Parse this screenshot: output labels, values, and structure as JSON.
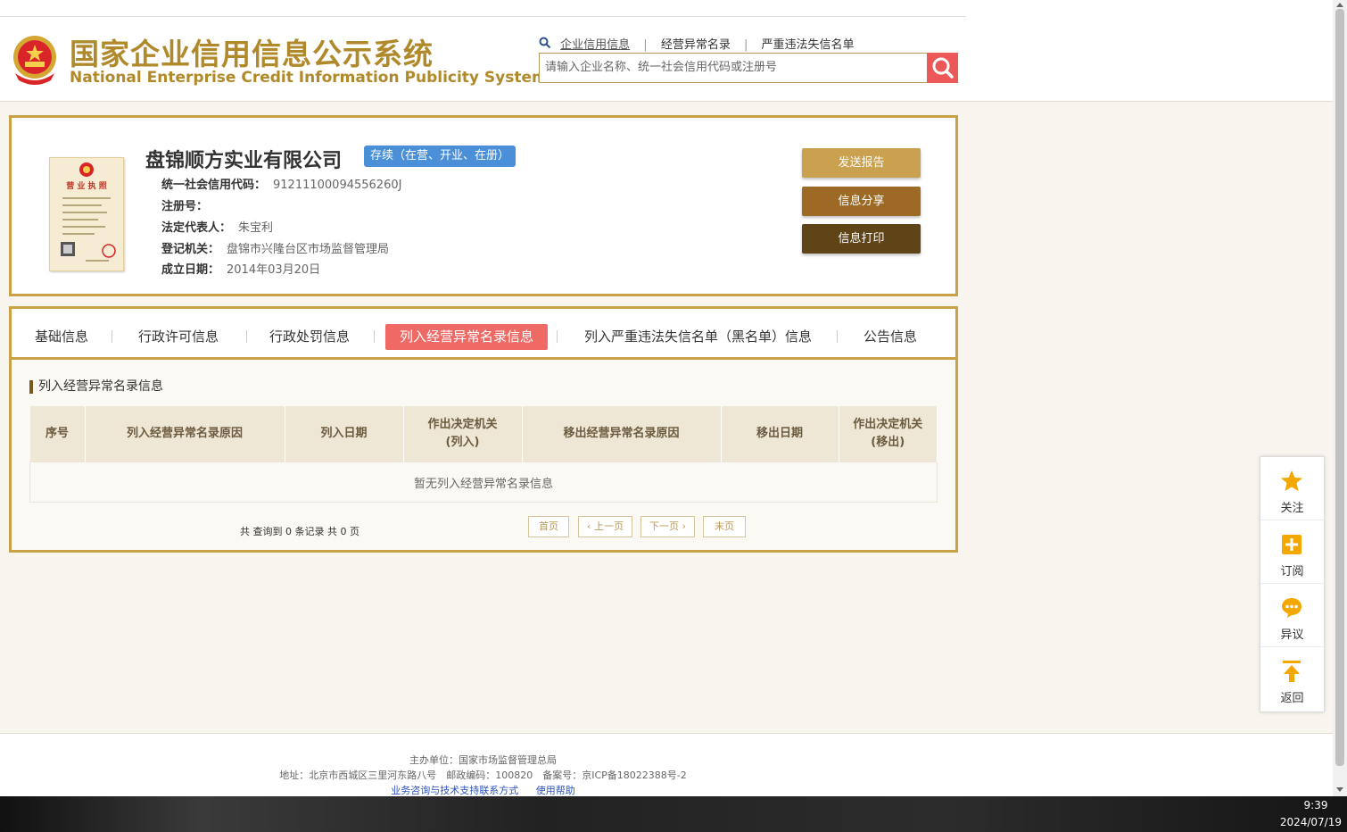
{
  "header": {
    "title": "国家企业信用信息公示系统",
    "subtitle": "National Enterprise Credit Information Publicity System",
    "search_tabs": [
      "企业信用信息",
      "经营异常名录",
      "严重违法失信名单"
    ],
    "search_placeholder": "请输入企业名称、统一社会信用代码或注册号"
  },
  "company": {
    "name": "盘锦顺方实业有限公司",
    "status": "存续（在营、开业、在册）",
    "fields": [
      {
        "label": "统一社会信用代码：",
        "value": "91211100094556260J"
      },
      {
        "label": "注册号：",
        "value": ""
      },
      {
        "label": "法定代表人：",
        "value": "朱宝利"
      },
      {
        "label": "登记机关：",
        "value": "盘锦市兴隆台区市场监督管理局"
      },
      {
        "label": "成立日期：",
        "value": "2014年03月20日"
      }
    ],
    "buttons": {
      "send_report": "发送报告",
      "share": "信息分享",
      "print": "信息打印"
    },
    "license_image": {
      "header": "营 业 执 照"
    }
  },
  "tabs": [
    "基础信息",
    "行政许可信息",
    "行政处罚信息",
    "列入经营异常名录信息",
    "列入严重违法失信名单（黑名单）信息",
    "公告信息"
  ],
  "section": {
    "title": "列入经营异常名录信息",
    "columns": [
      "序号",
      "列入经营异常名录原因",
      "列入日期",
      "作出决定机关\n(列入)",
      "移出经营异常名录原因",
      "移出日期",
      "作出决定机关\n(移出)"
    ],
    "empty_text": "暂无列入经营异常名录信息"
  },
  "pagination": {
    "summary": "共 查询到 0 条记录 共 0 页",
    "first": "首页",
    "prev": "上一页",
    "next": "下一页",
    "last": "末页"
  },
  "float_bar": [
    "关注",
    "订阅",
    "异议",
    "返回"
  ],
  "footer": {
    "host": "主办单位：国家市场监督管理总局",
    "address": "地址：北京市西城区三里河东路八号　邮政编码：100820　备案号：京ICP备18022388号-2",
    "links": [
      "业务咨询与技术支持联系方式",
      "使用帮助"
    ]
  },
  "taskbar": {
    "time": "9:39",
    "date": "2024/07/19"
  },
  "colors": {
    "gold": "#c9a146",
    "badge_blue": "#4a8fd8",
    "tab_active": "#ef6a65",
    "search_red": "#ec5758"
  }
}
